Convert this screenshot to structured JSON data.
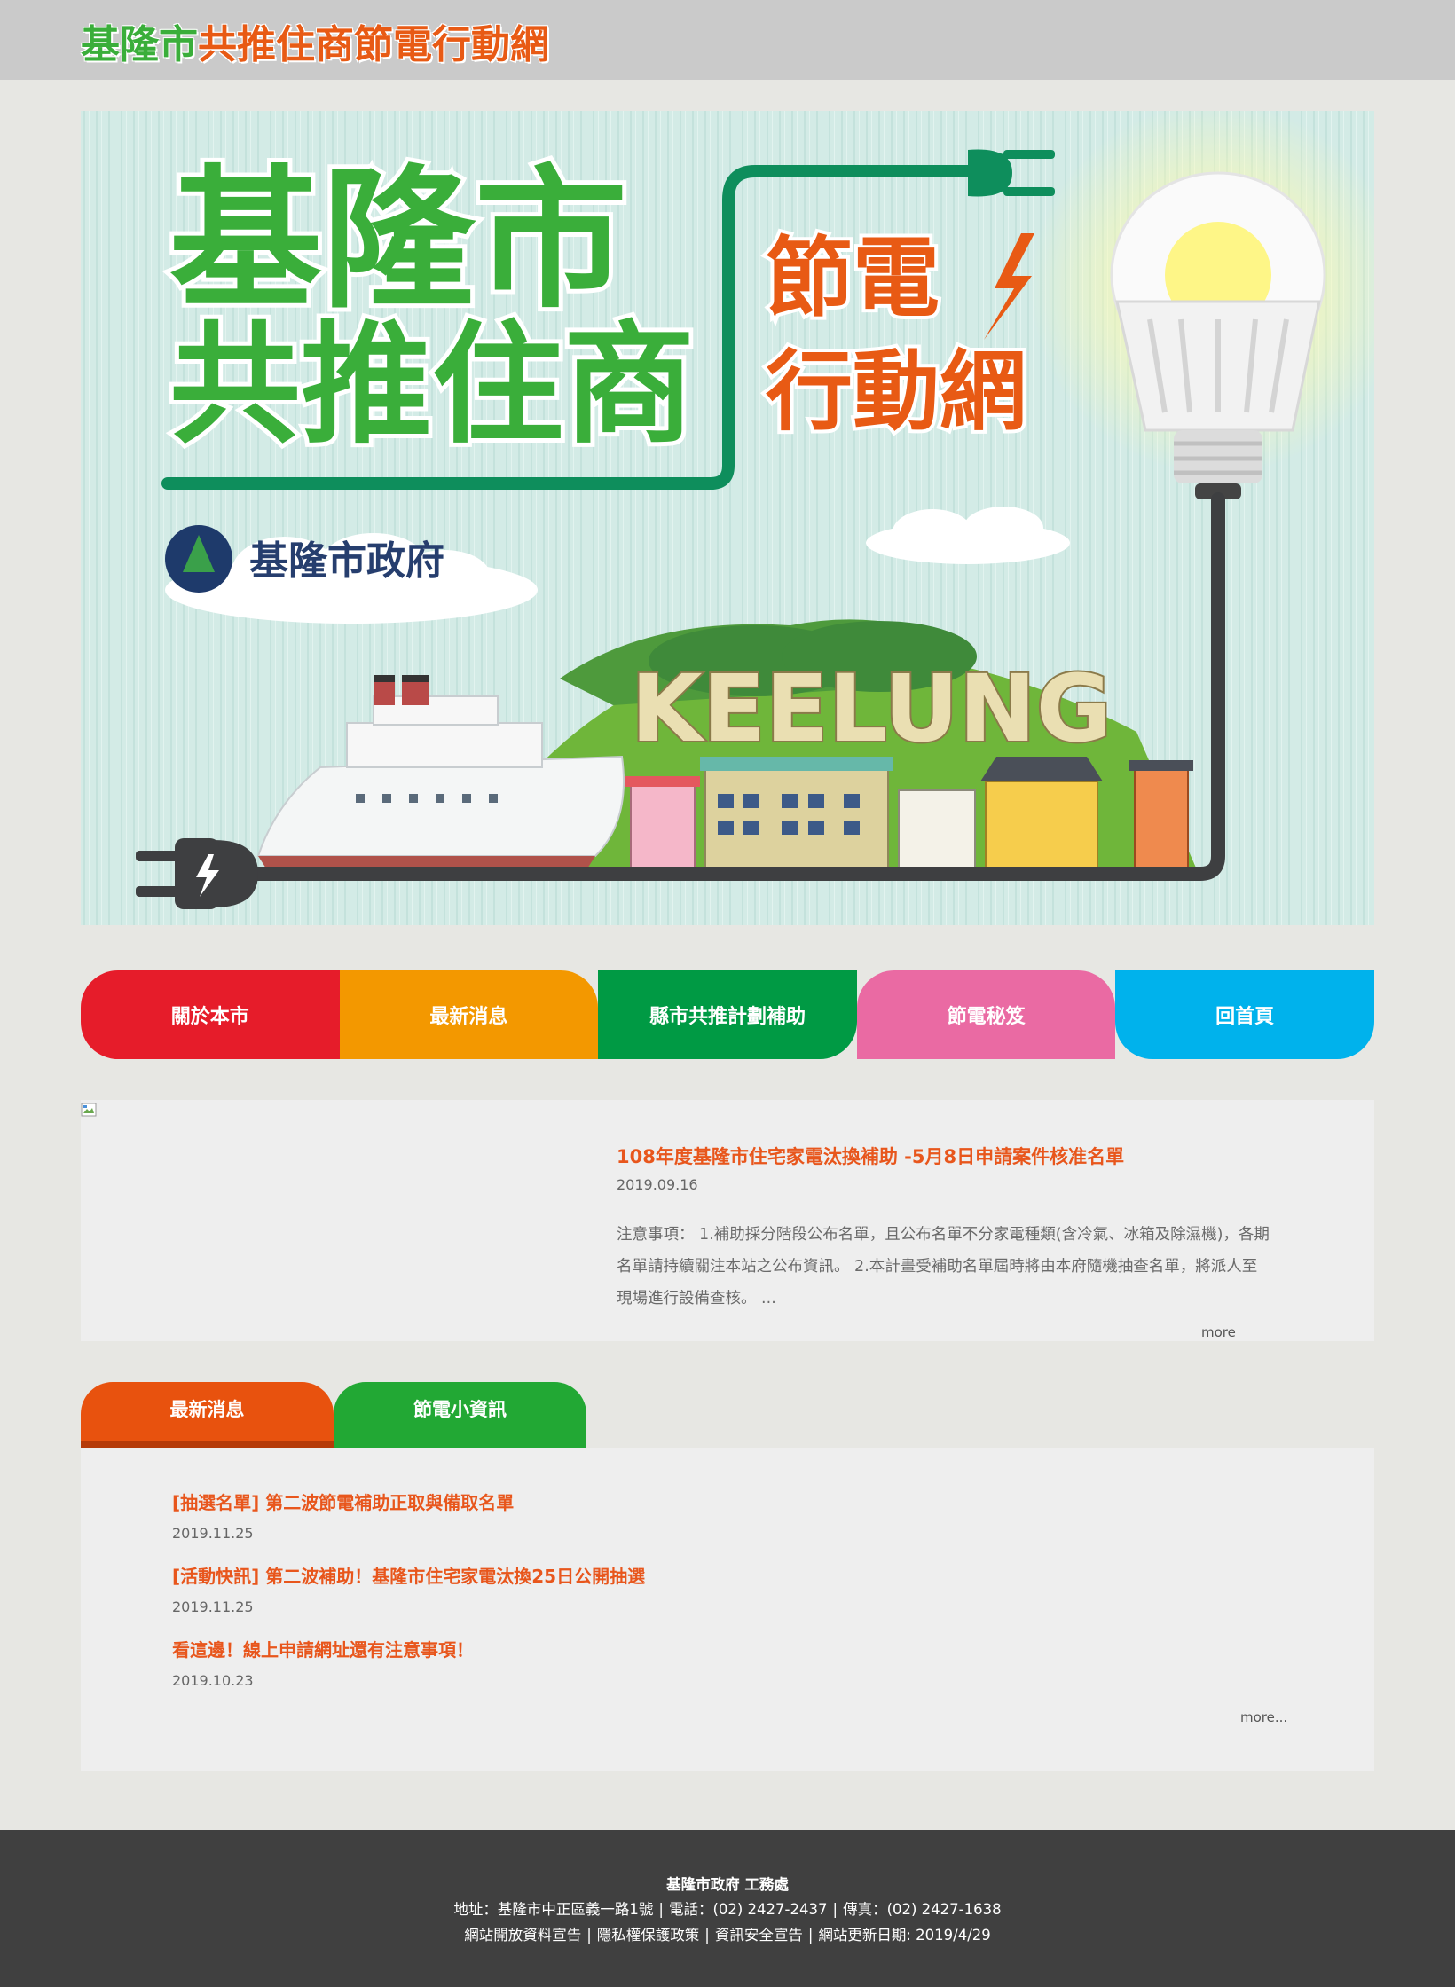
{
  "header": {
    "title_part1": "基隆市",
    "title_part2": "共推住商節電行動網"
  },
  "banner": {
    "headline_line1": "基隆市",
    "headline_line2": "共推住商",
    "tagline_line1": "節電",
    "tagline_line2": "行動網",
    "government_name": "基隆市政府",
    "city_word": "KEELUNG",
    "colors": {
      "sky": "#cfe9e4",
      "green": "#3aae3a",
      "orange": "#e85a14",
      "cable": "#444444"
    }
  },
  "nav": {
    "items": [
      {
        "label": "關於本市",
        "color": "#e61c2a"
      },
      {
        "label": "最新消息",
        "color": "#f39800"
      },
      {
        "label": "縣市共推計劃補助",
        "color": "#009a44"
      },
      {
        "label": "節電秘笈",
        "color": "#ea6aa3"
      },
      {
        "label": "回首頁",
        "color": "#00b2ec"
      }
    ]
  },
  "featured": {
    "title": "108年度基隆市住宅家電汰換補助 -5月8日申請案件核准名單",
    "date": "2019.09.16",
    "body_line1": "注意事項： 1.補助採分階段公布名單，且公布名單不分家電種類(含冷氣、冰箱及除濕機)，各期",
    "body_line2": "名單請持續關注本站之公布資訊。 2.本計畫受補助名單屆時將由本府隨機抽查名單，將派人至",
    "body_line3": "現場進行設備查核。 ...",
    "more": "more"
  },
  "tabs": {
    "items": [
      {
        "label": "最新消息",
        "active": true
      },
      {
        "label": "節電小資訊",
        "active": false
      }
    ]
  },
  "news": {
    "items": [
      {
        "title": "[抽選名單] 第二波節電補助正取與備取名單",
        "date": "2019.11.25"
      },
      {
        "title": "[活動快訊] 第二波補助！基隆市住宅家電汰換25日公開抽選",
        "date": "2019.11.25"
      },
      {
        "title": "看這邊！線上申請網址還有注意事項！",
        "date": "2019.10.23"
      }
    ],
    "more": "more..."
  },
  "footer": {
    "org": "基隆市政府 工務處",
    "address": "地址：基隆市中正區義一路1號",
    "phone": "電話：(02) 2427-2437",
    "fax": "傳真：(02) 2427-1638",
    "links": [
      "網站開放資料宣告",
      "隱私權保護政策",
      "資訊安全宣告"
    ],
    "updated": "網站更新日期: 2019/4/29"
  }
}
